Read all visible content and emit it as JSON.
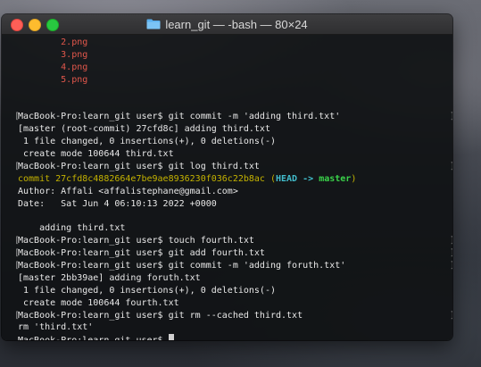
{
  "window": {
    "title": "learn_git — -bash — 80×24"
  },
  "terminal": {
    "lines": [
      {
        "text": "\t2.png",
        "style": "red"
      },
      {
        "text": "\t3.png",
        "style": "red"
      },
      {
        "text": "\t4.png",
        "style": "red"
      },
      {
        "text": "\t5.png",
        "style": "red"
      },
      {
        "text": "",
        "style": "plain"
      },
      {
        "text": "",
        "style": "plain"
      },
      {
        "text": "MacBook-Pro:learn_git user$ git commit -m 'adding third.txt'",
        "style": "plain",
        "bracket": true
      },
      {
        "text": "[master (root-commit) 27cfd8c] adding third.txt",
        "style": "plain"
      },
      {
        "text": " 1 file changed, 0 insertions(+), 0 deletions(-)",
        "style": "plain"
      },
      {
        "text": " create mode 100644 third.txt",
        "style": "plain"
      },
      {
        "text": "MacBook-Pro:learn_git user$ git log third.txt",
        "style": "plain",
        "bracket": true
      },
      {
        "text": "commit 27cfd8c4882664e7be9ae8936230f036c22b8ac",
        "style": "commit",
        "head": "HEAD",
        "arrow": " -> ",
        "branch": "master"
      },
      {
        "text": "Author: Affali <affalistephane@gmail.com>",
        "style": "plain"
      },
      {
        "text": "Date:   Sat Jun 4 06:10:13 2022 +0000",
        "style": "plain"
      },
      {
        "text": "",
        "style": "plain"
      },
      {
        "text": "    adding third.txt",
        "style": "plain"
      },
      {
        "text": "MacBook-Pro:learn_git user$ touch fourth.txt",
        "style": "plain",
        "bracket": true
      },
      {
        "text": "MacBook-Pro:learn_git user$ git add fourth.txt",
        "style": "plain",
        "bracket": true
      },
      {
        "text": "MacBook-Pro:learn_git user$ git commit -m 'adding foruth.txt'",
        "style": "plain",
        "bracket": true
      },
      {
        "text": "[master 2bb39ae] adding foruth.txt",
        "style": "plain"
      },
      {
        "text": " 1 file changed, 0 insertions(+), 0 deletions(-)",
        "style": "plain"
      },
      {
        "text": " create mode 100644 fourth.txt",
        "style": "plain"
      },
      {
        "text": "MacBook-Pro:learn_git user$ git rm --cached third.txt",
        "style": "plain",
        "bracket": true
      },
      {
        "text": "rm 'third.txt'",
        "style": "plain"
      },
      {
        "text": "MacBook-Pro:learn_git user$ ",
        "style": "prompt"
      }
    ]
  },
  "colors": {
    "close": "#fe5f57",
    "minimize": "#febc2e",
    "zoom": "#28c840",
    "error_red": "#e2574b",
    "commit_yellow": "#c5b300",
    "head_cyan": "#42bdcc",
    "branch_green": "#3ad34a"
  },
  "icons": {
    "title_folder": "folder-icon"
  }
}
